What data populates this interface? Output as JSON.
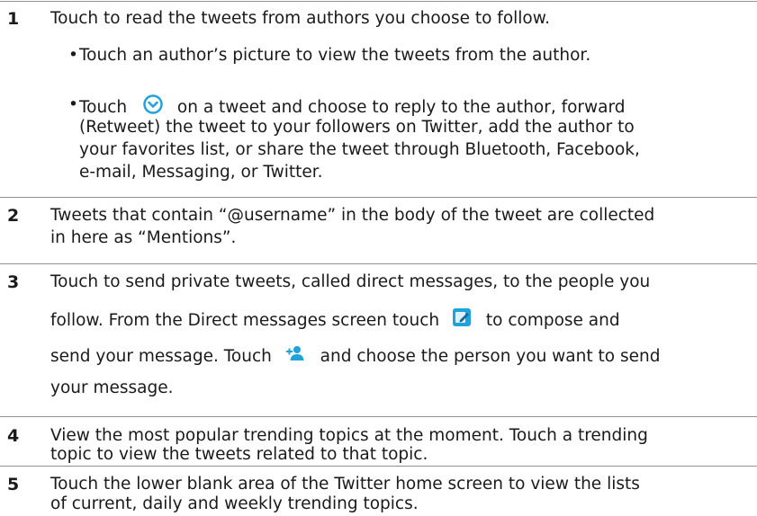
{
  "rows": [
    {
      "num": "1",
      "line": "Touch to read the tweets from authors you choose to follow.",
      "bullet1": "Touch an author’s picture to view the tweets from the author.",
      "bullet2": {
        "pre": "Touch",
        "post": "on a tweet and choose to reply to the author, forward",
        "l2": "(Retweet) the tweet to your followers on Twitter, add the author to",
        "l3": "your favorites list, or share the tweet through Bluetooth, Facebook,",
        "l4": "e-mail, Messaging, or Twitter."
      }
    },
    {
      "num": "2",
      "l1": "Tweets that contain “@username” in the body of the tweet are collected",
      "l2": "in here as “Mentions”."
    },
    {
      "num": "3",
      "l1": "Touch to send private tweets, called direct messages, to the people you",
      "l2a": "follow. From the Direct messages screen touch",
      "l2b": "to compose and",
      "l3a": "send your message. Touch",
      "l3b": "and choose the person you want to send",
      "l4": "your message."
    },
    {
      "num": "4",
      "l1": "View the most popular trending topics at the moment. Touch a trending",
      "l2": "topic to view the tweets related to that topic."
    },
    {
      "num": "5",
      "l1": "Touch the lower blank area of the Twitter home screen to view the lists",
      "l2": "of current, daily and weekly trending topics."
    }
  ],
  "icons": {
    "dropdown": "chevron-circle-icon",
    "compose": "compose-icon",
    "add_person": "add-person-icon",
    "accent": "#1fa3d8"
  }
}
